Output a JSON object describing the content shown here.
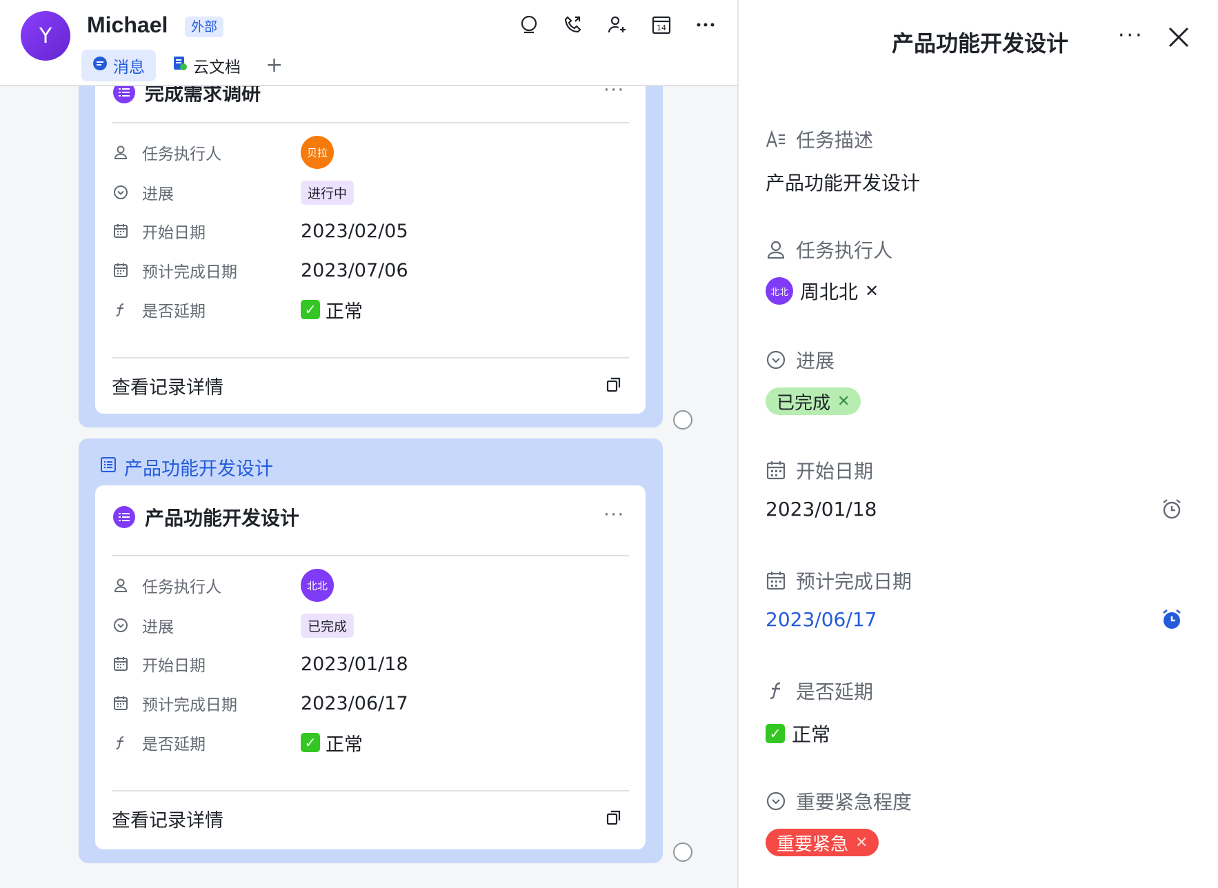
{
  "header": {
    "avatar_letter": "Y",
    "contact_name": "Michael",
    "badge": "外部",
    "tabs": [
      {
        "label": "消息",
        "icon": "chat-bubble-icon",
        "active": true
      },
      {
        "label": "云文档",
        "icon": "doc-icon",
        "active": false
      }
    ],
    "add_tab_label": "+",
    "icons": [
      "search-icon",
      "phone-icon",
      "add-contact-icon",
      "calendar-icon",
      "more-icon"
    ]
  },
  "messages": [
    {
      "card_title": "完成需求调研",
      "more": "···",
      "fields": [
        {
          "label": "任务执行人",
          "type": "avatar",
          "value": "贝拉",
          "color": "#f77a0c"
        },
        {
          "label": "进展",
          "type": "tag",
          "value": "进行中"
        },
        {
          "label": "开始日期",
          "type": "text",
          "value": "2023/02/05"
        },
        {
          "label": "预计完成日期",
          "type": "text",
          "value": "2023/07/06"
        },
        {
          "label": "是否延期",
          "type": "check",
          "value": "正常"
        }
      ],
      "view_detail": "查看记录详情"
    },
    {
      "bubble_title": "产品功能开发设计",
      "card_title": "产品功能开发设计",
      "more": "···",
      "fields": [
        {
          "label": "任务执行人",
          "type": "avatar",
          "value": "北北",
          "color": "#7f3bf5"
        },
        {
          "label": "进展",
          "type": "tag",
          "value": "已完成"
        },
        {
          "label": "开始日期",
          "type": "text",
          "value": "2023/01/18"
        },
        {
          "label": "预计完成日期",
          "type": "text",
          "value": "2023/06/17"
        },
        {
          "label": "是否延期",
          "type": "check",
          "value": "正常"
        }
      ],
      "view_detail": "查看记录详情"
    }
  ],
  "detail": {
    "title": "产品功能开发设计",
    "more": "···",
    "description_label": "任务描述",
    "description_value": "产品功能开发设计",
    "assignee_label": "任务执行人",
    "assignee_avatar": "北北",
    "assignee_name": "周北北",
    "progress_label": "进展",
    "progress_value": "已完成",
    "start_label": "开始日期",
    "start_value": "2023/01/18",
    "due_label": "预计完成日期",
    "due_value": "2023/06/17",
    "delay_label": "是否延期",
    "delay_value": "正常",
    "priority_label": "重要紧急程度",
    "priority_value": "重要紧急",
    "colors": {
      "accent": "#245bdb",
      "done": "#b7edb1",
      "urgent": "#f54a45",
      "purple": "#7f3bf5"
    }
  }
}
